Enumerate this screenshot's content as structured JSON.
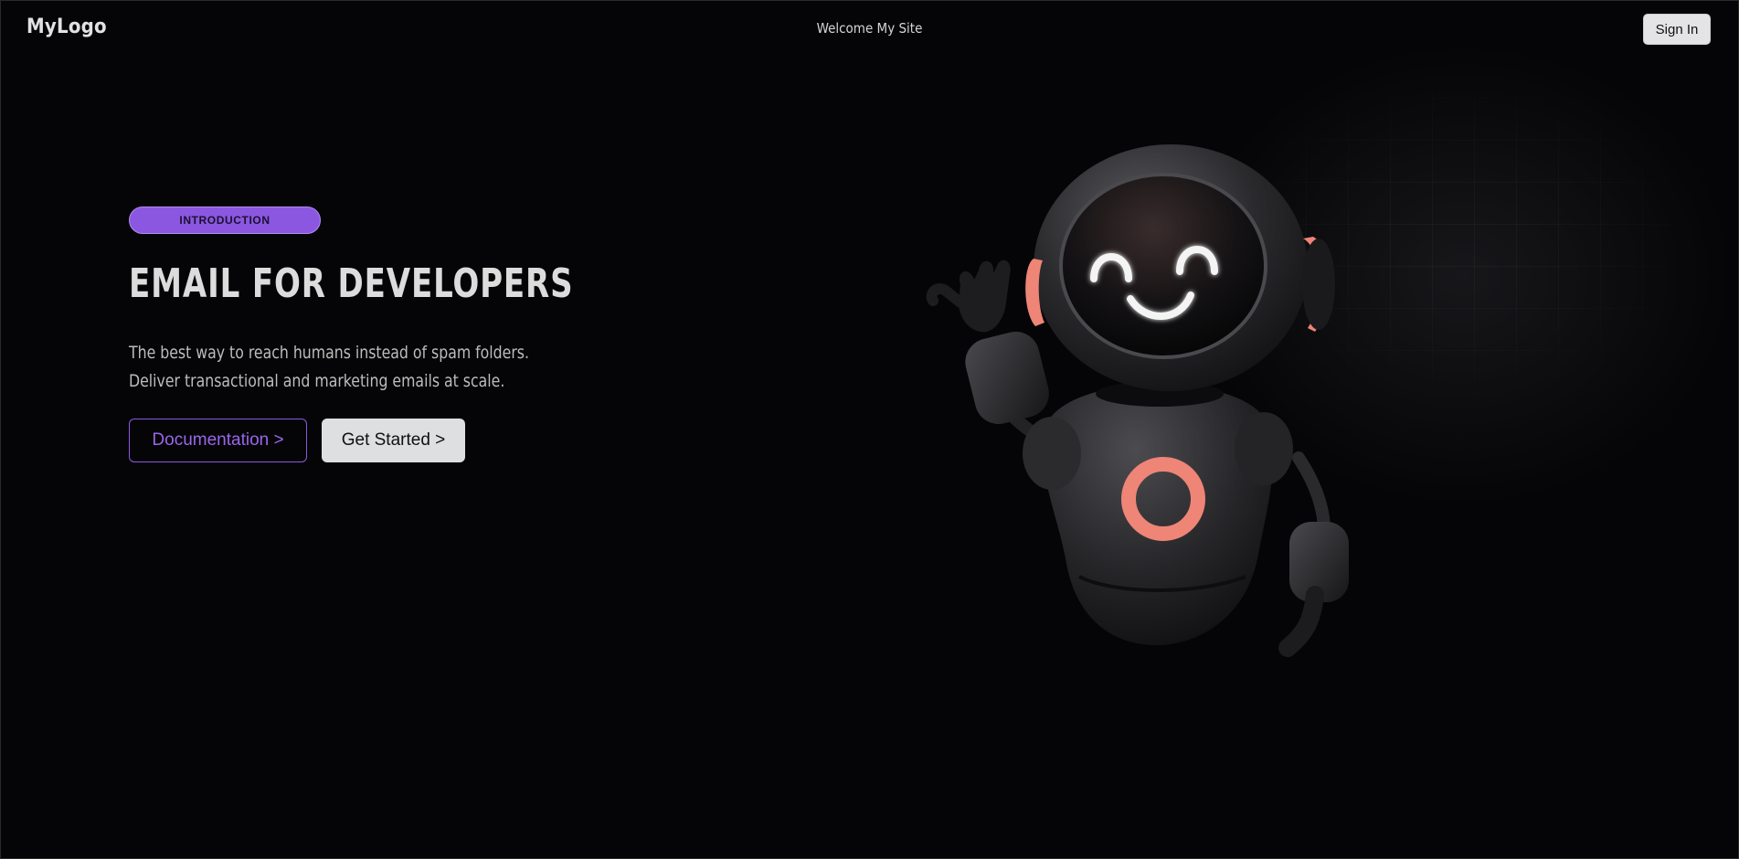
{
  "header": {
    "logo": "MyLogo",
    "welcome": "Welcome My Site",
    "sign_in_label": "Sign In"
  },
  "hero": {
    "badge": "INTRODUCTION",
    "title": "EMAIL FOR DEVELOPERS",
    "description_line1": "The best way to reach humans instead of spam folders.",
    "description_line2": "Deliver transactional and marketing emails at scale.",
    "documentation_label": "Documentation >",
    "get_started_label": "Get Started >"
  },
  "illustration": {
    "icon": "waving-robot-illustration"
  },
  "colors": {
    "background": "#050507",
    "accent_purple": "#8b57e0",
    "robot_accent": "#ee8576"
  }
}
